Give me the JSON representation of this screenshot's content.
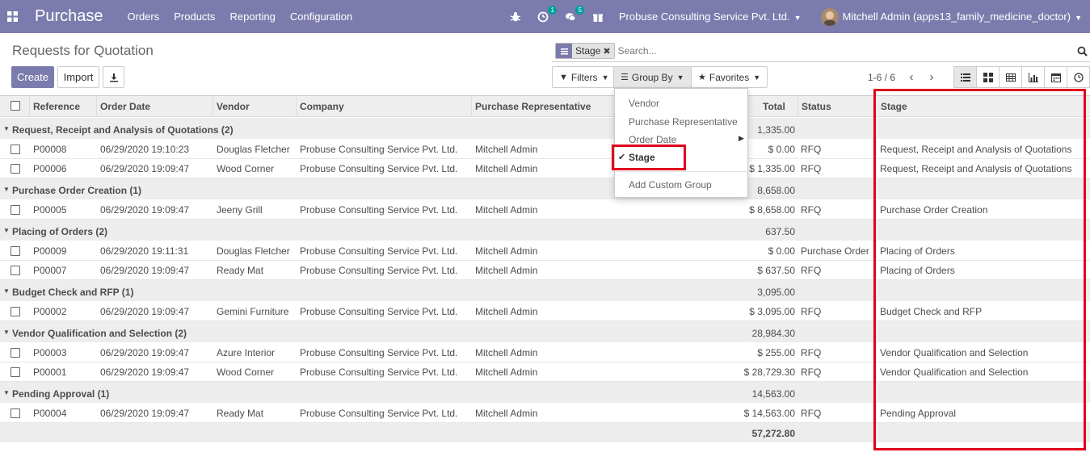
{
  "navbar": {
    "brand": "Purchase",
    "menu": [
      "Orders",
      "Products",
      "Reporting",
      "Configuration"
    ],
    "activity_badge": "1",
    "messages_badge": "5",
    "company": "Probuse Consulting Service Pvt. Ltd.",
    "user": "Mitchell Admin (apps13_family_medicine_doctor)"
  },
  "control_panel": {
    "title": "Requests for Quotation",
    "create_label": "Create",
    "import_label": "Import",
    "facet_value": "Stage",
    "search_placeholder": "Search...",
    "filters_label": "Filters",
    "group_by_label": "Group By",
    "favorites_label": "Favorites",
    "pager": "1-6 / 6"
  },
  "table": {
    "columns": [
      "Reference",
      "Order Date",
      "Vendor",
      "Company",
      "Purchase Representative",
      "Total",
      "Status",
      "Stage"
    ],
    "groups": [
      {
        "label": "Request, Receipt and Analysis of Quotations (2)",
        "total": "1,335.00",
        "rows": [
          {
            "ref": "P00008",
            "date": "06/29/2020 19:10:23",
            "vendor": "Douglas Fletcher",
            "company": "Probuse Consulting Service Pvt. Ltd.",
            "rep": "Mitchell Admin",
            "total": "$ 0.00",
            "status": "RFQ",
            "stage": "Request, Receipt and Analysis of Quotations"
          },
          {
            "ref": "P00006",
            "date": "06/29/2020 19:09:47",
            "vendor": "Wood Corner",
            "company": "Probuse Consulting Service Pvt. Ltd.",
            "rep": "Mitchell Admin",
            "total": "$ 1,335.00",
            "status": "RFQ",
            "stage": "Request, Receipt and Analysis of Quotations"
          }
        ]
      },
      {
        "label": "Purchase Order Creation (1)",
        "total": "8,658.00",
        "rows": [
          {
            "ref": "P00005",
            "date": "06/29/2020 19:09:47",
            "vendor": "Jeeny Grill",
            "company": "Probuse Consulting Service Pvt. Ltd.",
            "rep": "Mitchell Admin",
            "total": "$ 8,658.00",
            "status": "RFQ",
            "stage": "Purchase Order Creation"
          }
        ]
      },
      {
        "label": "Placing of Orders (2)",
        "total": "637.50",
        "rows": [
          {
            "ref": "P00009",
            "date": "06/29/2020 19:11:31",
            "vendor": "Douglas Fletcher",
            "company": "Probuse Consulting Service Pvt. Ltd.",
            "rep": "Mitchell Admin",
            "total": "$ 0.00",
            "status": "Purchase Order",
            "stage": "Placing of Orders"
          },
          {
            "ref": "P00007",
            "date": "06/29/2020 19:09:47",
            "vendor": "Ready Mat",
            "company": "Probuse Consulting Service Pvt. Ltd.",
            "rep": "Mitchell Admin",
            "total": "$ 637.50",
            "status": "RFQ",
            "stage": "Placing of Orders"
          }
        ]
      },
      {
        "label": "Budget Check and RFP (1)",
        "total": "3,095.00",
        "rows": [
          {
            "ref": "P00002",
            "date": "06/29/2020 19:09:47",
            "vendor": "Gemini Furniture",
            "company": "Probuse Consulting Service Pvt. Ltd.",
            "rep": "Mitchell Admin",
            "total": "$ 3,095.00",
            "status": "RFQ",
            "stage": "Budget Check and RFP"
          }
        ]
      },
      {
        "label": "Vendor Qualification and Selection (2)",
        "total": "28,984.30",
        "rows": [
          {
            "ref": "P00003",
            "date": "06/29/2020 19:09:47",
            "vendor": "Azure Interior",
            "company": "Probuse Consulting Service Pvt. Ltd.",
            "rep": "Mitchell Admin",
            "total": "$ 255.00",
            "status": "RFQ",
            "stage": "Vendor Qualification and Selection"
          },
          {
            "ref": "P00001",
            "date": "06/29/2020 19:09:47",
            "vendor": "Wood Corner",
            "company": "Probuse Consulting Service Pvt. Ltd.",
            "rep": "Mitchell Admin",
            "total": "$ 28,729.30",
            "status": "RFQ",
            "stage": "Vendor Qualification and Selection"
          }
        ]
      },
      {
        "label": "Pending Approval (1)",
        "total": "14,563.00",
        "rows": [
          {
            "ref": "P00004",
            "date": "06/29/2020 19:09:47",
            "vendor": "Ready Mat",
            "company": "Probuse Consulting Service Pvt. Ltd.",
            "rep": "Mitchell Admin",
            "total": "$ 14,563.00",
            "status": "RFQ",
            "stage": "Pending Approval"
          }
        ]
      }
    ],
    "grand_total": "57,272.80"
  },
  "group_by_menu": {
    "items": [
      "Vendor",
      "Purchase Representative",
      "Order Date",
      "Stage"
    ],
    "add_custom": "Add Custom Group"
  },
  "colors": {
    "brand": "#7c7bad",
    "highlight": "#e0001b"
  }
}
